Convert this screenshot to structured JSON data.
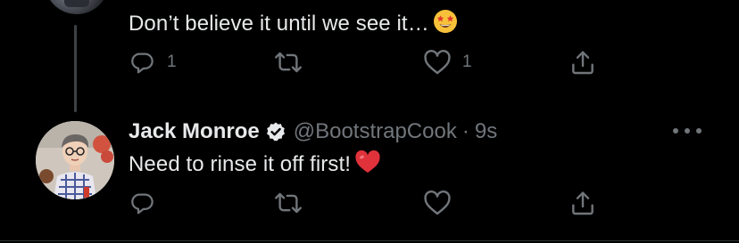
{
  "colors": {
    "background": "#000000",
    "text": "#e7e9ea",
    "muted": "#71767b",
    "heart": "#e0323b",
    "verified": "#e7e9ea"
  },
  "tweets": [
    {
      "text": "Don’t believe it until we see it…",
      "emoji": "star-struck-face",
      "actions": {
        "reply_icon": "reply-icon",
        "reply_count": "1",
        "retweet_icon": "retweet-icon",
        "retweet_count": "",
        "like_icon": "heart-icon",
        "like_count": "1",
        "share_icon": "share-icon"
      }
    },
    {
      "author": {
        "name": "Jack Monroe",
        "handle": "@BootstrapCook",
        "separator": "·",
        "time": "9s",
        "verified_icon": "verified-badge-icon"
      },
      "text": "Need to rinse it off first!",
      "emoji": "red-heart",
      "actions": {
        "reply_icon": "reply-icon",
        "reply_count": "",
        "retweet_icon": "retweet-icon",
        "retweet_count": "",
        "like_icon": "heart-icon",
        "like_count": "",
        "share_icon": "share-icon"
      },
      "more_icon": "more-options-icon"
    }
  ]
}
